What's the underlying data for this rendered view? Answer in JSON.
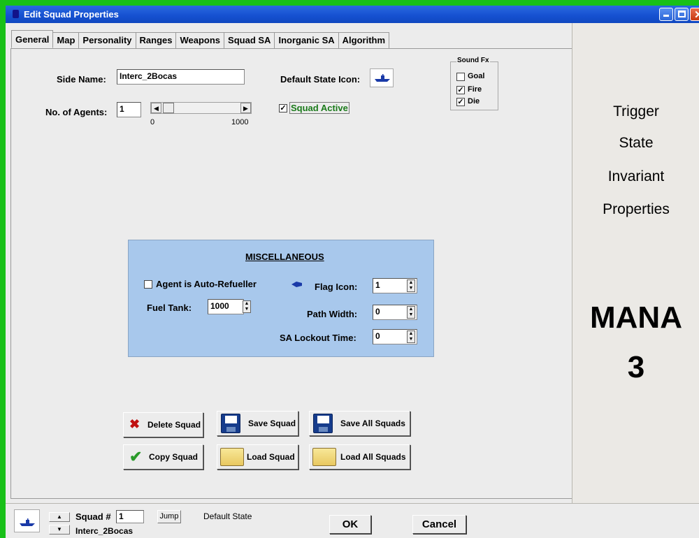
{
  "window": {
    "title": "Edit Squad Properties"
  },
  "tabs": [
    "General",
    "Map",
    "Personality",
    "Ranges",
    "Weapons",
    "Squad SA",
    "Inorganic SA",
    "Algorithm"
  ],
  "general": {
    "side_name_label": "Side Name:",
    "side_name_value": "Interc_2Bocas",
    "num_agents_label": "No. of Agents:",
    "num_agents_value": "1",
    "slider_min": "0",
    "slider_max": "1000",
    "slider_value": 1,
    "default_state_icon_label": "Default State Icon:",
    "squad_active_label": "Squad Active",
    "squad_active_checked": true
  },
  "sound_fx": {
    "title": "Sound Fx",
    "items": [
      {
        "label": "Goal",
        "checked": false
      },
      {
        "label": "Fire",
        "checked": true
      },
      {
        "label": "Die",
        "checked": true
      }
    ]
  },
  "misc": {
    "title": "MISCELLANEOUS",
    "auto_refueller_label": "Agent is Auto-Refueller",
    "auto_refueller_checked": false,
    "fuel_tank_label": "Fuel Tank:",
    "fuel_tank_value": "1000",
    "flag_icon_label": "Flag Icon:",
    "flag_icon_value": "1",
    "path_width_label": "Path Width:",
    "path_width_value": "0",
    "sa_lockout_label": "SA Lockout Time:",
    "sa_lockout_value": "0"
  },
  "buttons": {
    "delete_squad": "Delete Squad",
    "save_squad": "Save Squad",
    "save_all_squads": "Save All Squads",
    "copy_squad": "Copy Squad",
    "load_squad": "Load Squad",
    "load_all_squads": "Load All Squads"
  },
  "right_panel": {
    "words": [
      "Trigger",
      "State",
      "Invariant",
      "Properties"
    ],
    "mana": "MANA",
    "version": "3"
  },
  "bottom": {
    "squad_label": "Squad #",
    "squad_number": "1",
    "jump_label": "Jump",
    "default_state_label": "Default State",
    "squad_name": "Interc_2Bocas",
    "ok_label": "OK",
    "cancel_label": "Cancel"
  },
  "colors": {
    "title_bar": "#1550d0",
    "border_green": "#18c018",
    "misc_panel": "#a8c8ec",
    "squad_active_text": "#1a7a1a",
    "ship_icon": "#1a3aa8"
  },
  "icons": [
    "ship-icon",
    "flag-icon",
    "delete-icon",
    "check-icon",
    "floppy-icon",
    "folder-icon"
  ]
}
